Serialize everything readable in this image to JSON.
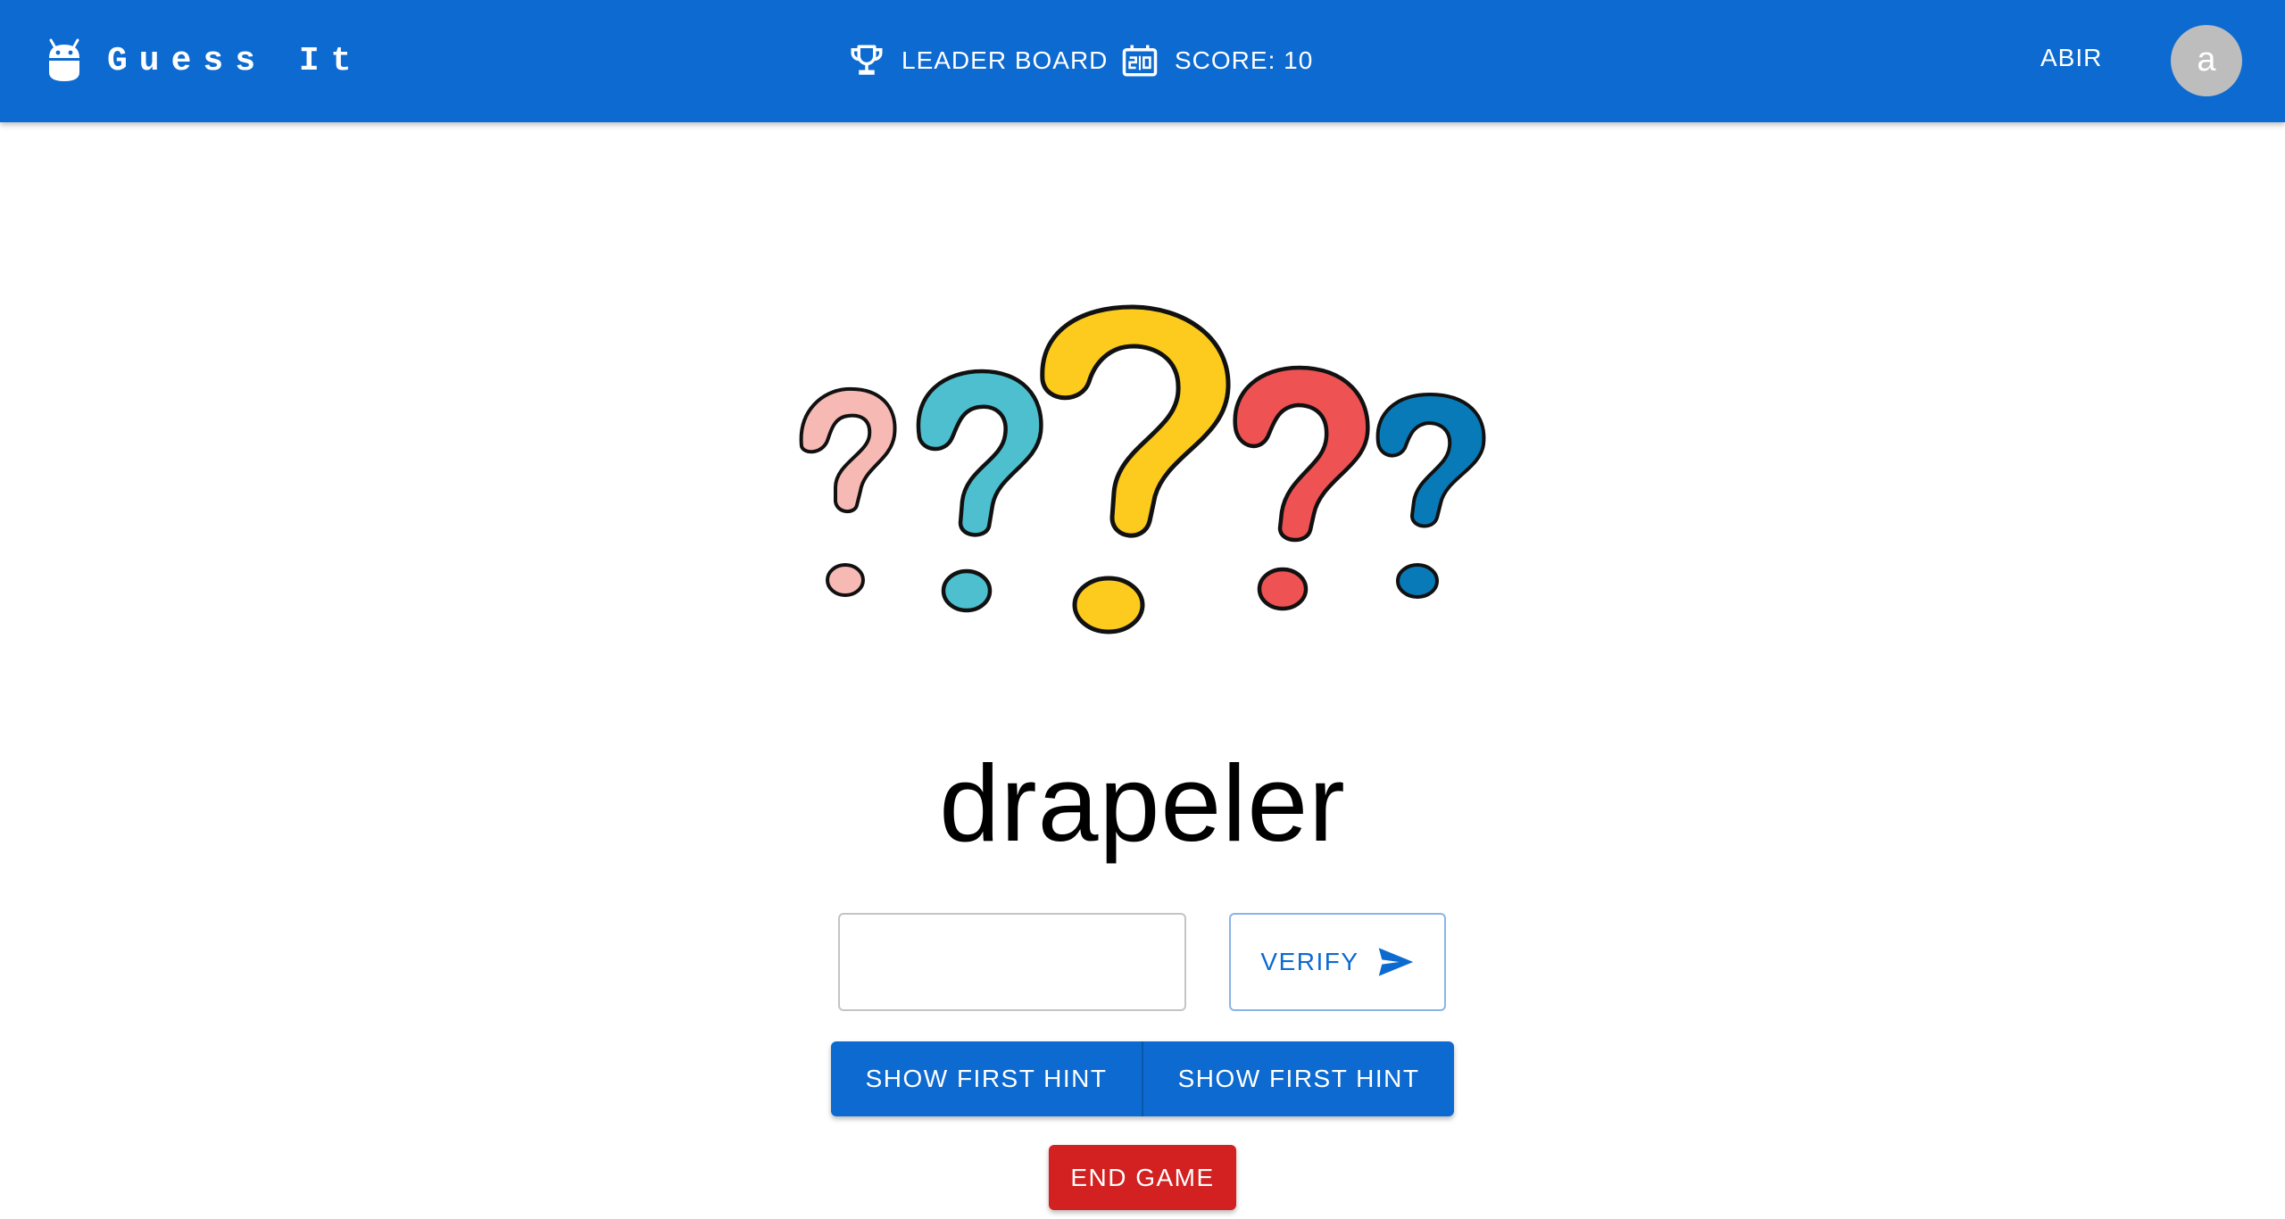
{
  "app": {
    "title": "Guess It",
    "logo_icon": "android-icon"
  },
  "nav": {
    "leaderboard": {
      "label": "LEADER BOARD",
      "icon": "trophy-icon"
    },
    "score": {
      "label": "SCORE: 10",
      "icon": "scoreboard-icon"
    }
  },
  "user": {
    "name": "ABIR",
    "avatar_initial": "a"
  },
  "illustration": {
    "icon": "question-marks-illustration",
    "colors": [
      "#f7b9b3",
      "#4dbfcf",
      "#fccb1d",
      "#ee5253",
      "#087ab8"
    ]
  },
  "game": {
    "scrambled_word": "drapeler",
    "guess_input": {
      "value": "",
      "placeholder": ""
    },
    "verify_label": "VERIFY",
    "verify_icon": "send-icon",
    "hints": [
      "SHOW FIRST HINT",
      "SHOW FIRST HINT"
    ],
    "end_label": "END GAME"
  },
  "colors": {
    "primary": "#0d6ad0",
    "danger": "#d32020",
    "avatar_bg": "#bdbdbd"
  }
}
